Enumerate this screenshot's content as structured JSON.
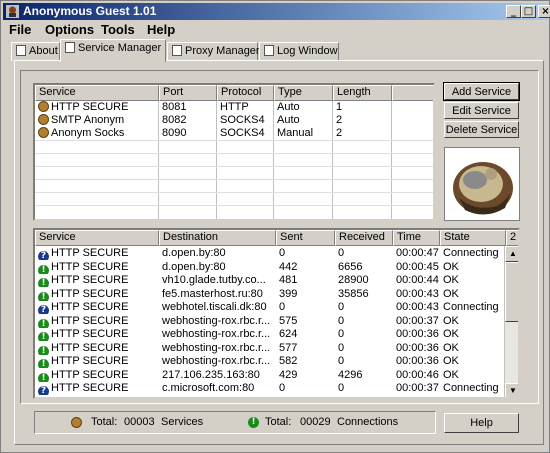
{
  "window": {
    "title": "Anonymous Guest 1.01",
    "controls": {
      "minimize": "_",
      "maximize": "□",
      "close": "×"
    }
  },
  "menu": [
    "File",
    "Options",
    "Tools",
    "Help"
  ],
  "tabs": [
    {
      "label": "About",
      "active": false
    },
    {
      "label": "Service Manager",
      "active": true
    },
    {
      "label": "Proxy Manager",
      "active": false
    },
    {
      "label": "Log Window",
      "active": false
    }
  ],
  "services_table": {
    "columns": [
      "Service",
      "Port",
      "Protocol",
      "Type",
      "Length"
    ],
    "rows": [
      [
        "HTTP SECURE",
        "8081",
        "HTTP",
        "Auto",
        "1"
      ],
      [
        "SMTP Anonym",
        "8082",
        "SOCKS4",
        "Auto",
        "2"
      ],
      [
        "Anonym Socks",
        "8090",
        "SOCKS4",
        "Manual",
        "2"
      ]
    ]
  },
  "buttons": {
    "add_service": "Add Service",
    "edit_service": "Edit Service",
    "delete_service": "Delete Service",
    "help": "Help"
  },
  "connections_table": {
    "columns": [
      "Service",
      "Destination",
      "Sent",
      "Received",
      "Time",
      "State",
      "2"
    ],
    "rows": [
      {
        "state_icon": "connecting",
        "cells": [
          "HTTP SECURE",
          "d.open.by:80",
          "0",
          "0",
          "00:00:47",
          "Connecting",
          "2"
        ]
      },
      {
        "state_icon": "ok",
        "cells": [
          "HTTP SECURE",
          "d.open.by:80",
          "442",
          "6656",
          "00:00:45",
          "OK",
          "2"
        ]
      },
      {
        "state_icon": "ok",
        "cells": [
          "HTTP SECURE",
          "vh10.glade.tutby.co...",
          "481",
          "28900",
          "00:00:44",
          "OK",
          "2"
        ]
      },
      {
        "state_icon": "ok",
        "cells": [
          "HTTP SECURE",
          "fe5.masterhost.ru:80",
          "399",
          "35856",
          "00:00:43",
          "OK",
          "2"
        ]
      },
      {
        "state_icon": "connecting",
        "cells": [
          "HTTP SECURE",
          "webhotel.tiscali.dk:80",
          "0",
          "0",
          "00:00:43",
          "Connecting",
          "2"
        ]
      },
      {
        "state_icon": "ok",
        "cells": [
          "HTTP SECURE",
          "webhosting-rox.rbc.r...",
          "575",
          "0",
          "00:00:37",
          "OK",
          "2"
        ]
      },
      {
        "state_icon": "ok",
        "cells": [
          "HTTP SECURE",
          "webhosting-rox.rbc.r...",
          "624",
          "0",
          "00:00:36",
          "OK",
          "2"
        ]
      },
      {
        "state_icon": "ok",
        "cells": [
          "HTTP SECURE",
          "webhosting-rox.rbc.r...",
          "577",
          "0",
          "00:00:36",
          "OK",
          "2"
        ]
      },
      {
        "state_icon": "ok",
        "cells": [
          "HTTP SECURE",
          "webhosting-rox.rbc.r...",
          "582",
          "0",
          "00:00:36",
          "OK",
          "2"
        ]
      },
      {
        "state_icon": "ok",
        "cells": [
          "HTTP SECURE",
          "217.106.235.163:80",
          "429",
          "4296",
          "00:00:46",
          "OK",
          "2"
        ]
      },
      {
        "state_icon": "connecting",
        "cells": [
          "HTTP SECURE",
          "c.microsoft.com:80",
          "0",
          "0",
          "00:00:37",
          "Connecting",
          "2"
        ]
      }
    ]
  },
  "status": {
    "services_label": "Total:",
    "services_count": "00003",
    "services_unit": "Services",
    "connections_label": "Total:",
    "connections_count": "00029",
    "connections_unit": "Connections"
  },
  "colors": {
    "titlebar_start": "#0a246a",
    "titlebar_end": "#a6caf0",
    "state_ok": "#1a8a1a",
    "state_connecting": "#1a3a8a"
  }
}
